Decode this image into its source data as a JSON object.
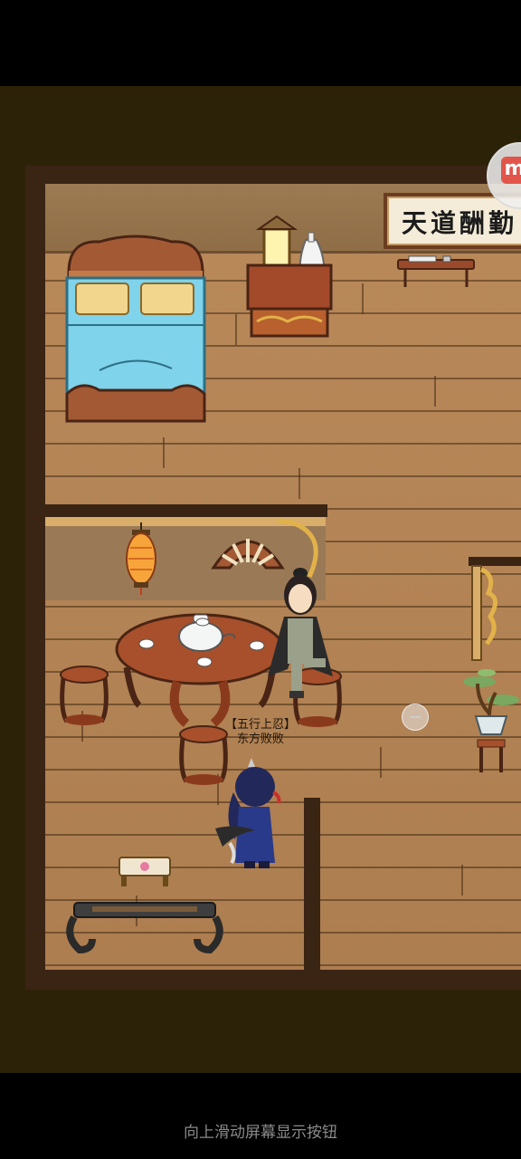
{
  "scene": {
    "plaque_text": "天道酬勤",
    "npc": {
      "title": "【五行上忍】",
      "name": "东方败败"
    },
    "floating_logo_text": "m"
  },
  "footer": {
    "hint": "向上滑动屏幕显示按钮"
  }
}
